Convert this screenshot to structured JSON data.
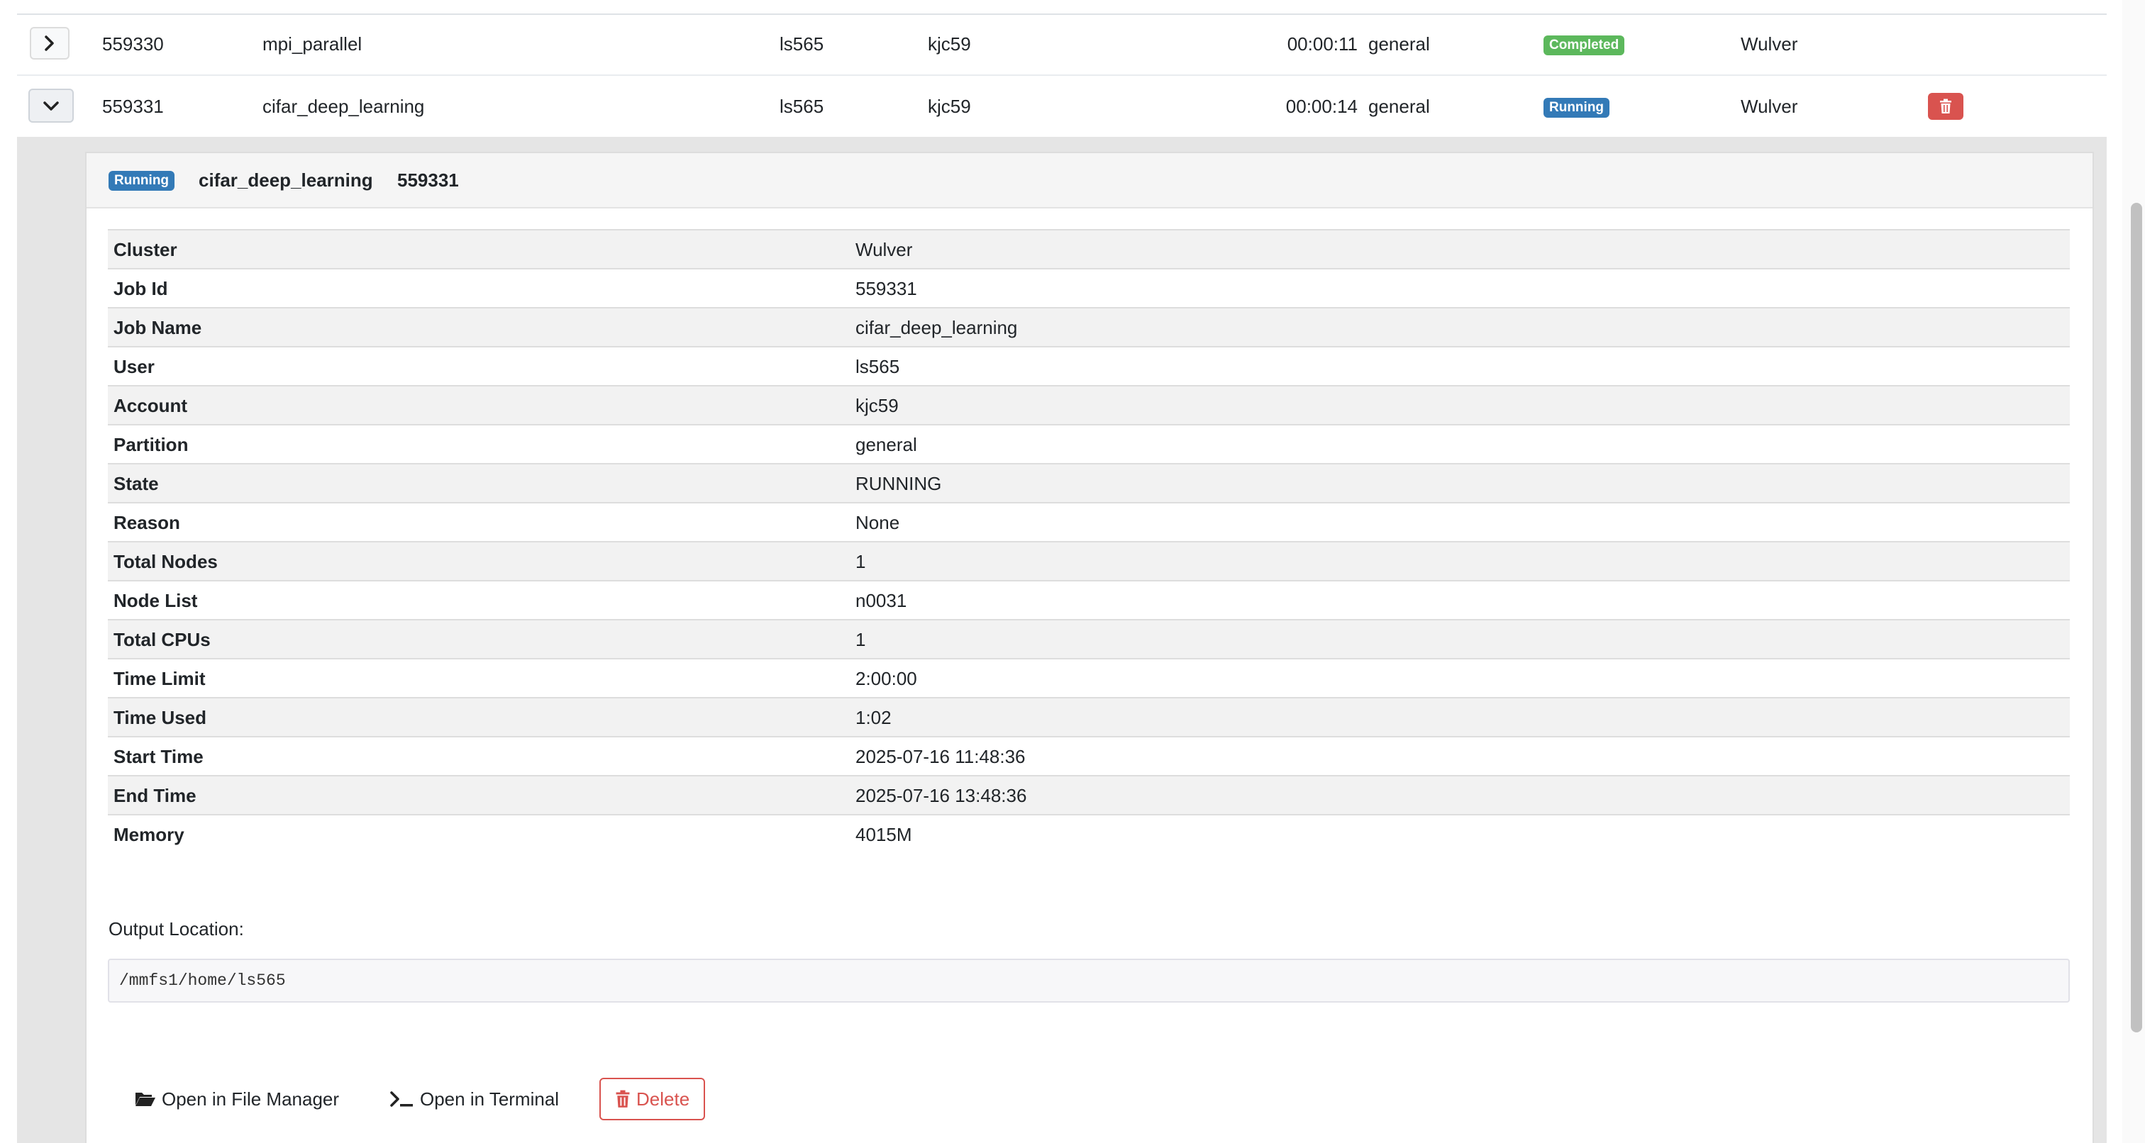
{
  "jobs": [
    {
      "id": "559330",
      "name": "mpi_parallel",
      "user": "ls565",
      "account": "kjc59",
      "time": "00:00:11",
      "partition": "general",
      "state": "Completed",
      "cluster": "Wulver"
    },
    {
      "id": "559331",
      "name": "cifar_deep_learning",
      "user": "ls565",
      "account": "kjc59",
      "time": "00:00:14",
      "partition": "general",
      "state": "Running",
      "cluster": "Wulver"
    }
  ],
  "detail": {
    "badge": "Running",
    "title_name": "cifar_deep_learning",
    "title_id": "559331",
    "rows": [
      {
        "label": "Cluster",
        "value": "Wulver"
      },
      {
        "label": "Job Id",
        "value": "559331"
      },
      {
        "label": "Job Name",
        "value": "cifar_deep_learning"
      },
      {
        "label": "User",
        "value": "ls565"
      },
      {
        "label": "Account",
        "value": "kjc59"
      },
      {
        "label": "Partition",
        "value": "general"
      },
      {
        "label": "State",
        "value": "RUNNING"
      },
      {
        "label": "Reason",
        "value": "None"
      },
      {
        "label": "Total Nodes",
        "value": "1"
      },
      {
        "label": "Node List",
        "value": "n0031"
      },
      {
        "label": "Total CPUs",
        "value": "1"
      },
      {
        "label": "Time Limit",
        "value": "2:00:00"
      },
      {
        "label": "Time Used",
        "value": "1:02"
      },
      {
        "label": "Start Time",
        "value": "2025-07-16 11:48:36"
      },
      {
        "label": "End Time",
        "value": "2025-07-16 13:48:36"
      },
      {
        "label": "Memory",
        "value": "4015M"
      }
    ],
    "output_label": "Output Location:",
    "output_path": "/mmfs1/home/ls565",
    "actions": {
      "file_manager": "Open in File Manager",
      "terminal": "Open in Terminal",
      "delete": "Delete"
    }
  },
  "icons": {
    "expand": "chevron-right-icon",
    "collapse": "chevron-down-icon",
    "trash": "trash-icon",
    "folder": "folder-open-icon",
    "terminal": "terminal-icon"
  },
  "colors": {
    "completed": "#5cb85c",
    "running": "#337ab7",
    "danger": "#d9534f"
  }
}
